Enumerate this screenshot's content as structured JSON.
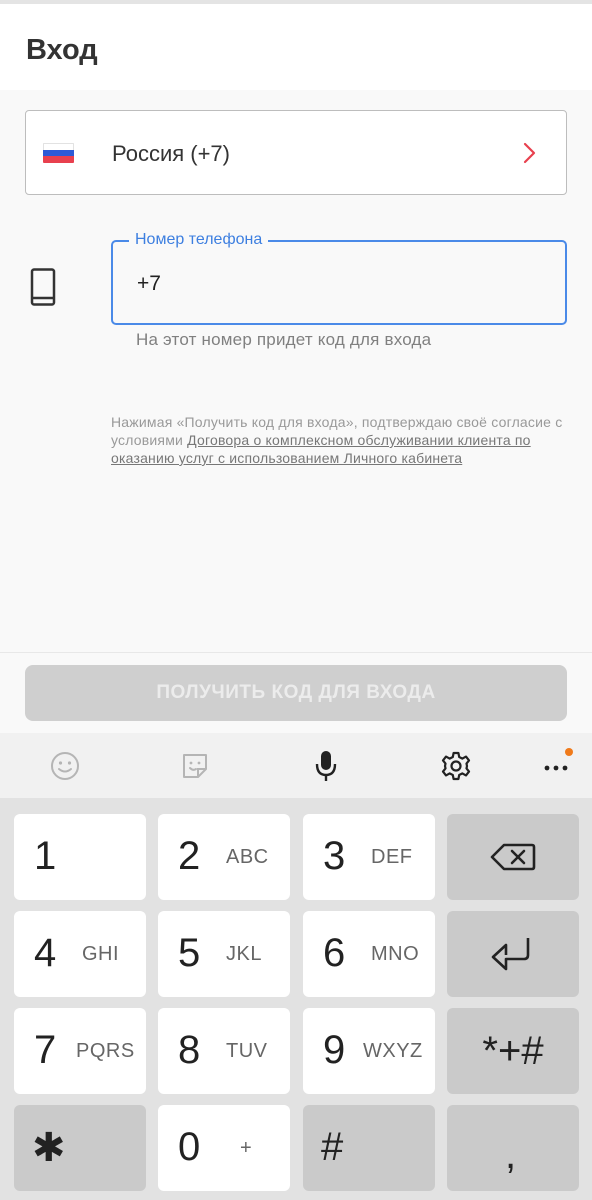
{
  "header": {
    "title": "Вход"
  },
  "country": {
    "flag_icon": "russia-flag-icon",
    "label": "Россия (+7)",
    "chevron_color": "#e8404e"
  },
  "phone": {
    "label": "Номер телефона",
    "value": "+7",
    "hint": "На этот номер придет код для входа",
    "icon": "smartphone-icon",
    "accent": "#4a8ae8"
  },
  "legal": {
    "text": "Нажимая «Получить код для входа», подтверждаю своё согласие с условиями ",
    "link": "Договора о комплексном обслуживании клиента по оказанию услуг с использованием Личного кабинета"
  },
  "submit": {
    "label": "ПОЛУЧИТЬ КОД ДЛЯ ВХОДА",
    "enabled": false
  },
  "keyboard": {
    "toolbar": [
      "emoji-icon",
      "sticker-icon",
      "microphone-icon",
      "settings-gear-icon",
      "more-icon"
    ],
    "more_badge_color": "#f07a1a",
    "keys": [
      {
        "num": "1",
        "letters": ""
      },
      {
        "num": "2",
        "letters": "ABC"
      },
      {
        "num": "3",
        "letters": "DEF"
      },
      {
        "num": "4",
        "letters": "GHI"
      },
      {
        "num": "5",
        "letters": "JKL"
      },
      {
        "num": "6",
        "letters": "MNO"
      },
      {
        "num": "7",
        "letters": "PQRS"
      },
      {
        "num": "8",
        "letters": "TUV"
      },
      {
        "num": "9",
        "letters": "WXYZ"
      },
      {
        "num": "0",
        "letters": "+"
      }
    ],
    "symbols": {
      "star_key": "*+#",
      "asterisk": "✱",
      "hash": "#",
      "comma": ","
    },
    "function_icons": [
      "backspace-icon",
      "enter-icon"
    ]
  }
}
